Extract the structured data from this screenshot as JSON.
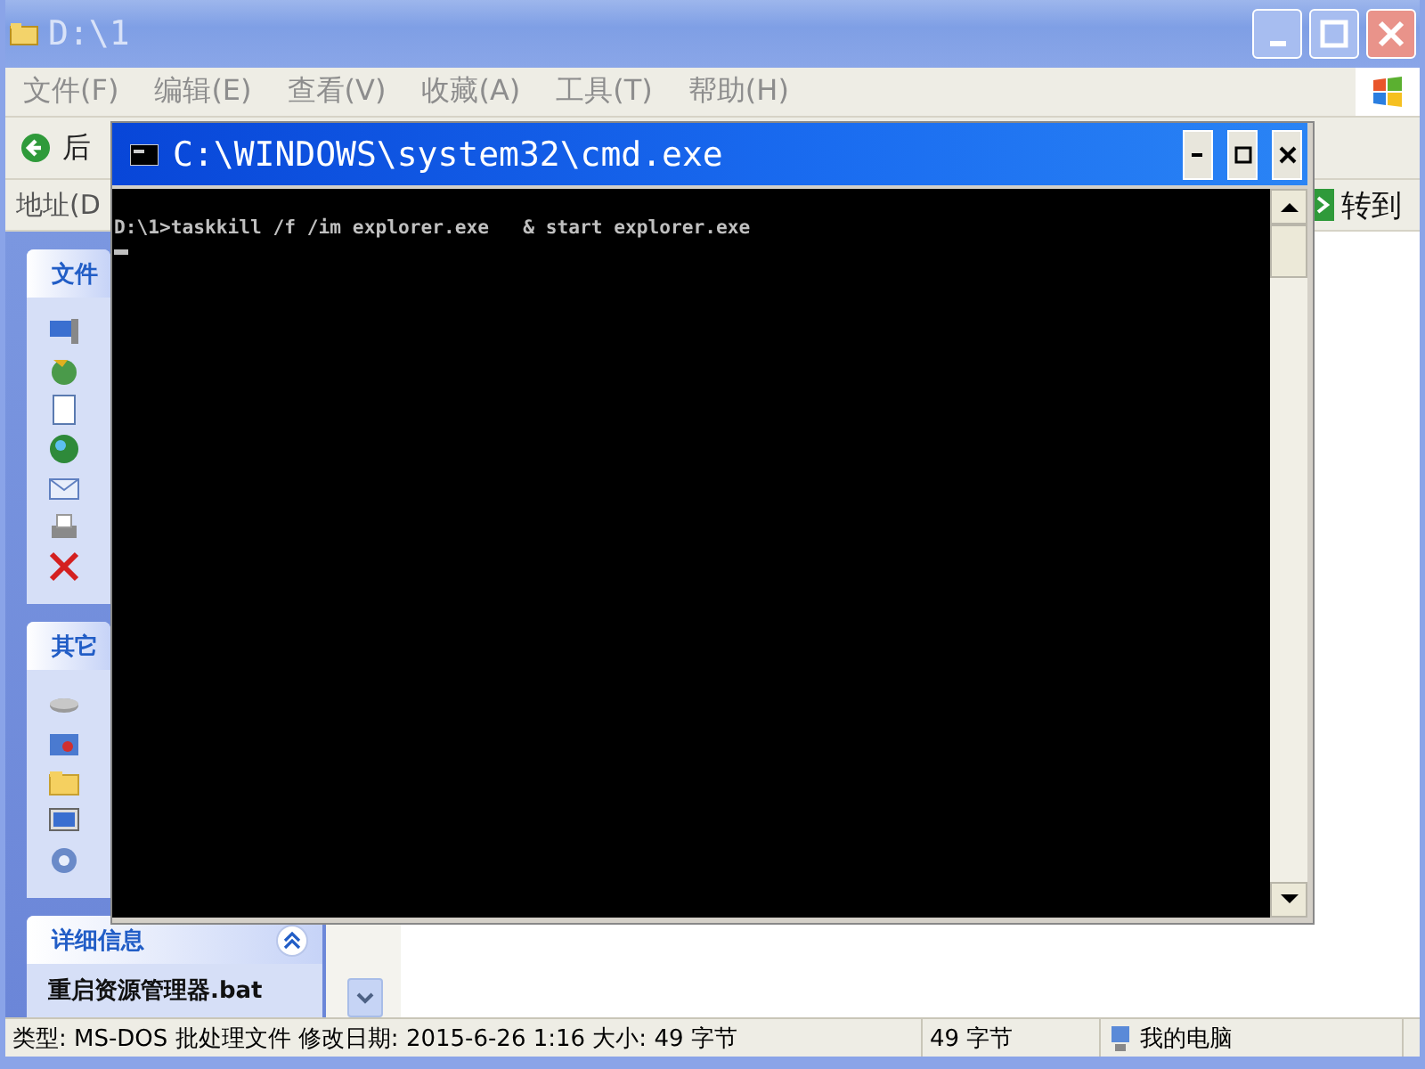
{
  "explorer": {
    "title": "D:\\1",
    "menu": [
      "文件(F)",
      "编辑(E)",
      "查看(V)",
      "收藏(A)",
      "工具(T)",
      "帮助(H)"
    ],
    "toolbar": {
      "back_label": "后"
    },
    "address": {
      "label": "地址(D",
      "go_label": "转到"
    },
    "sidebar": [
      {
        "kind": "file_tasks",
        "title": "文件"
      },
      {
        "kind": "other_places",
        "title": "其它"
      },
      {
        "kind": "details",
        "title": "详细信息",
        "expanded": true,
        "file_name": "重启资源管理器.bat"
      }
    ],
    "status_bar": [
      "类型: MS-DOS 批处理文件 修改日期: 2015-6-26 1:16 大小: 49 字节",
      "49 字节",
      "我的电脑"
    ]
  },
  "console": {
    "title": "C:\\WINDOWS\\system32\\cmd.exe",
    "lines": [
      "D:\\1>taskkill /f /im explorer.exe   & start explorer.exe"
    ],
    "cursor": true
  }
}
